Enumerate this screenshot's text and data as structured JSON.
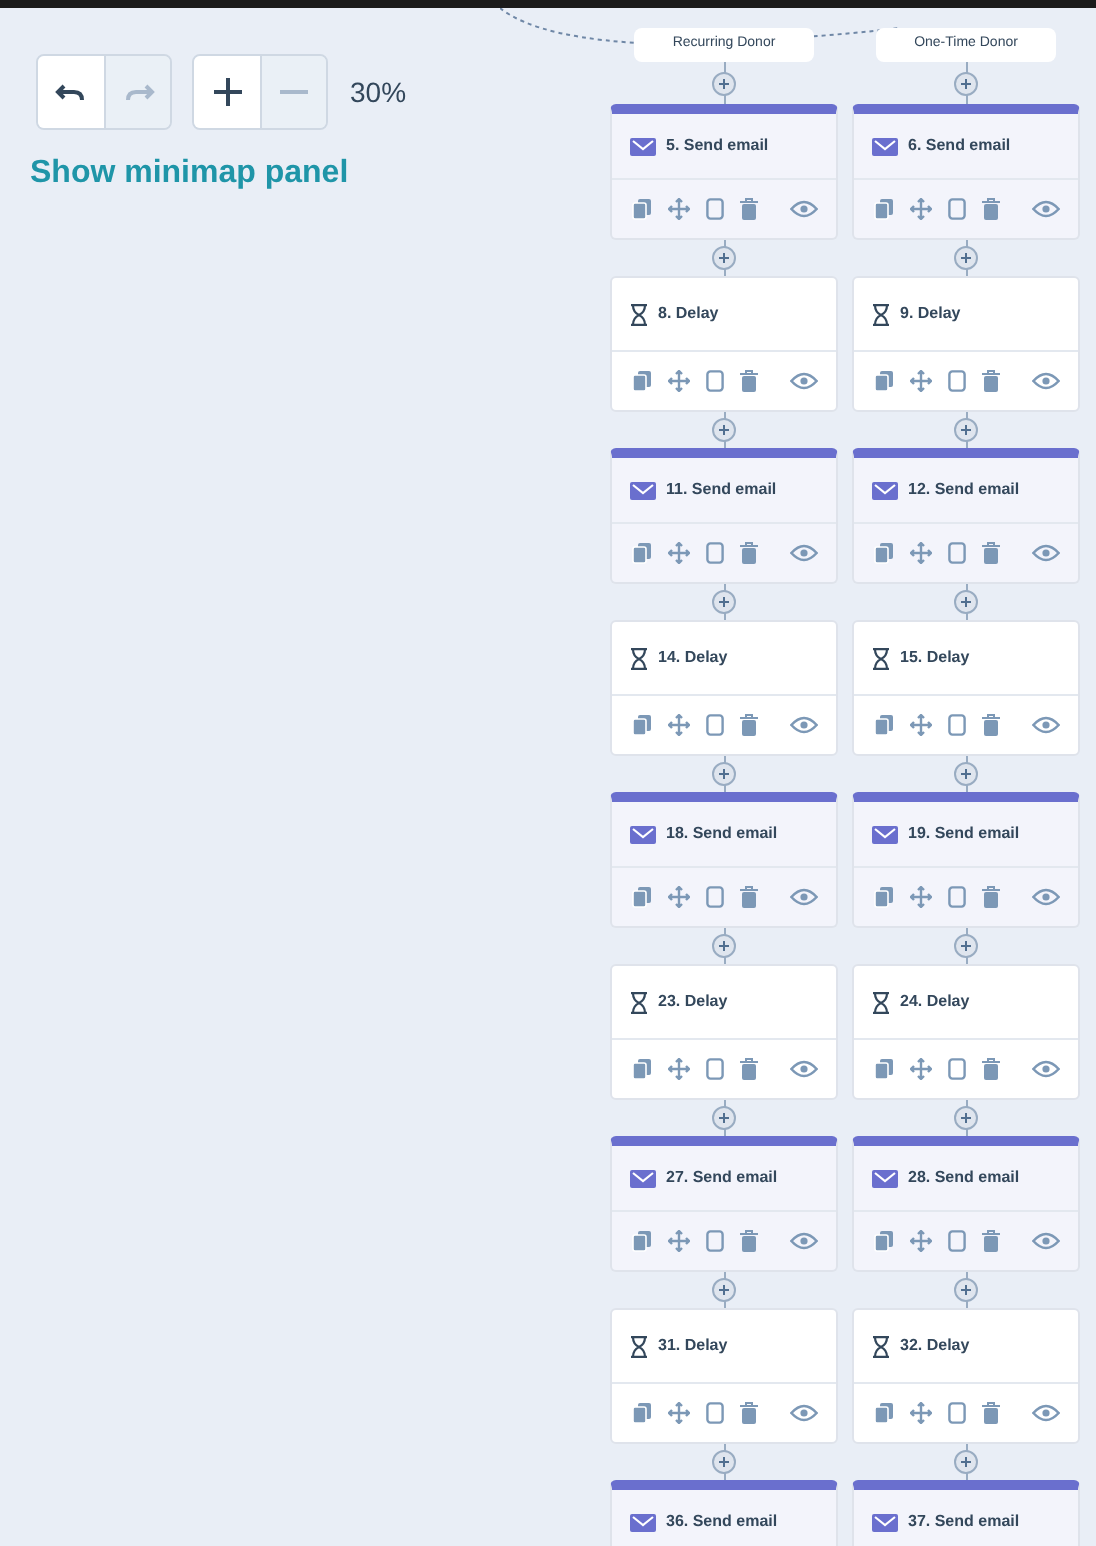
{
  "toolbar": {
    "history": [
      {
        "kind": "undo",
        "disabled": false
      },
      {
        "kind": "redo",
        "disabled": true
      }
    ],
    "zoom": [
      {
        "kind": "zoom-in",
        "disabled": false
      },
      {
        "kind": "zoom-out",
        "disabled": true
      }
    ],
    "zoom_level": "30%"
  },
  "minimap_link": "Show minimap panel",
  "branches": [
    {
      "label": "Recurring Donor",
      "steps": [
        {
          "kind": "email",
          "title": "5. Send email"
        },
        {
          "kind": "delay",
          "title": "8. Delay"
        },
        {
          "kind": "email",
          "title": "11. Send email"
        },
        {
          "kind": "delay",
          "title": "14. Delay"
        },
        {
          "kind": "email",
          "title": "18. Send email"
        },
        {
          "kind": "delay",
          "title": "23. Delay"
        },
        {
          "kind": "email",
          "title": "27. Send email"
        },
        {
          "kind": "delay",
          "title": "31. Delay"
        },
        {
          "kind": "email",
          "title": "36. Send email"
        }
      ]
    },
    {
      "label": "One-Time Donor",
      "steps": [
        {
          "kind": "email",
          "title": "6. Send email"
        },
        {
          "kind": "delay",
          "title": "9. Delay"
        },
        {
          "kind": "email",
          "title": "12. Send email"
        },
        {
          "kind": "delay",
          "title": "15. Delay"
        },
        {
          "kind": "email",
          "title": "19. Send email"
        },
        {
          "kind": "delay",
          "title": "24. Delay"
        },
        {
          "kind": "email",
          "title": "28. Send email"
        },
        {
          "kind": "delay",
          "title": "32. Delay"
        },
        {
          "kind": "email",
          "title": "37. Send email"
        }
      ]
    }
  ]
}
